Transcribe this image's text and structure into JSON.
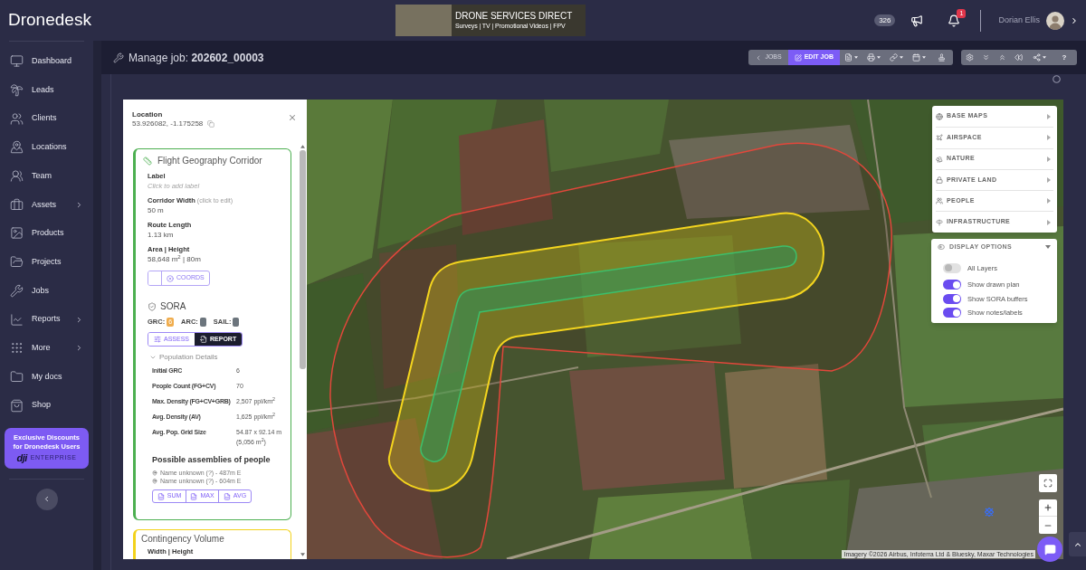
{
  "header": {
    "logo": "Dronedesk",
    "banner": {
      "title": "DRONE SERVICES DIRECT",
      "subtitle": "Surveys | TV | Promotional Videos | FPV"
    },
    "counter": "326",
    "notifications": "1",
    "user_name": "Dorian Ellis"
  },
  "sidebar": {
    "items": [
      {
        "label": "Dashboard",
        "submenu": false
      },
      {
        "label": "Leads",
        "submenu": false
      },
      {
        "label": "Clients",
        "submenu": false
      },
      {
        "label": "Locations",
        "submenu": false
      },
      {
        "label": "Team",
        "submenu": false
      },
      {
        "label": "Assets",
        "submenu": true
      },
      {
        "label": "Products",
        "submenu": false
      },
      {
        "label": "Projects",
        "submenu": false
      },
      {
        "label": "Jobs",
        "submenu": false
      },
      {
        "label": "Reports",
        "submenu": true
      },
      {
        "label": "More",
        "submenu": true
      },
      {
        "label": "My docs",
        "submenu": false
      },
      {
        "label": "Shop",
        "submenu": false
      }
    ],
    "promo": {
      "lines": [
        "Exclusive Discounts",
        "for Dronedesk Users"
      ],
      "logo": "dji",
      "brand": "ENTERPRISE"
    }
  },
  "job_bar": {
    "title": "Manage job: **202602_00003**",
    "nav_buttons": [
      {
        "label": "JOBS",
        "selected": false
      },
      {
        "label": "EDIT JOB",
        "selected": true
      }
    ],
    "tool_buttons": [
      {
        "dropdown": true
      },
      {
        "dropdown": true
      },
      {
        "dropdown": true
      },
      {
        "dropdown": true
      },
      {
        "dropdown": false
      }
    ],
    "action_buttons": [
      {
        "dropdown": false
      },
      {
        "dropdown": false
      },
      {
        "dropdown": false
      },
      {
        "dropdown": false
      },
      {
        "dropdown": true
      }
    ],
    "help_label": "?"
  },
  "details_panel": {
    "location": {
      "heading": "Location",
      "coords": "53.926082, -1.175258"
    },
    "sections": [
      {
        "kind": "corridor",
        "color": "#4caf50",
        "title": "Flight Geography Corridor",
        "fields": [
          {
            "label": "Label",
            "placeholder": "Click to add label"
          },
          {
            "label": "Corridor Width",
            "hint": "(click to edit)",
            "value": "50 m"
          },
          {
            "label": "Route Length",
            "value": "1.13 km"
          },
          {
            "label": "Area | Height",
            "value": "58,648 m$^{2}$ | 80m"
          }
        ],
        "coords_button": "COORDS",
        "sora": {
          "title": "SORA",
          "ratings": [
            {
              "label": "GRC:",
              "value": "6",
              "color": "#f0ad4e"
            },
            {
              "label": "ARC:",
              "color": "#6c757d"
            },
            {
              "label": "SAIL:",
              "color": "#6c757d"
            }
          ],
          "buttons": [
            {
              "label": "ASSESS",
              "kind": "outline"
            },
            {
              "label": "REPORT",
              "kind": "solid"
            }
          ],
          "population": {
            "heading": "Population Details",
            "expanded": true,
            "rows": [
              {
                "label": "Initial GRC",
                "value": "6"
              },
              {
                "label": "People Count (FG+CV)",
                "value": "70"
              },
              {
                "label": "Max. Density (FG+CV+GRB)",
                "value": "2,507 ppl/km$^{2}$"
              },
              {
                "label": "Avg. Density (AV)",
                "value": "1,625 ppl/km$^{2}$"
              },
              {
                "label": "Avg. Pop. Grid Size",
                "value": "54.87 x 92.14 m (5,056 m$^{2}$)"
              }
            ]
          },
          "assemblies": {
            "heading": "Possible assemblies of people",
            "items": [
              "Name unknown (?) - 487m E",
              "Name unknown (?) - 604m E"
            ],
            "buttons": [
              "SUM",
              "MAX",
              "AVG"
            ]
          }
        }
      },
      {
        "kind": "contingency",
        "color": "#f2d21b",
        "title": "Contingency Volume",
        "fields": [
          {
            "label": "Width | Height"
          }
        ]
      }
    ]
  },
  "map": {
    "layers": [
      "BASE MAPS",
      "AIRSPACE",
      "NATURE",
      "PRIVATE LAND",
      "PEOPLE",
      "INFRASTRUCTURE"
    ],
    "display_options": {
      "title": "DISPLAY OPTIONS",
      "expanded": true,
      "toggles": [
        {
          "label": "All Layers",
          "on": false
        },
        {
          "label": "Show drawn plan",
          "on": true
        },
        {
          "label": "Show SORA buffers",
          "on": true
        },
        {
          "label": "Show notes/labels",
          "on": true
        }
      ]
    },
    "attribution": "Imagery ©2026 Airbus, Infoterra Ltd & Bluesky, Maxar Technologies"
  }
}
